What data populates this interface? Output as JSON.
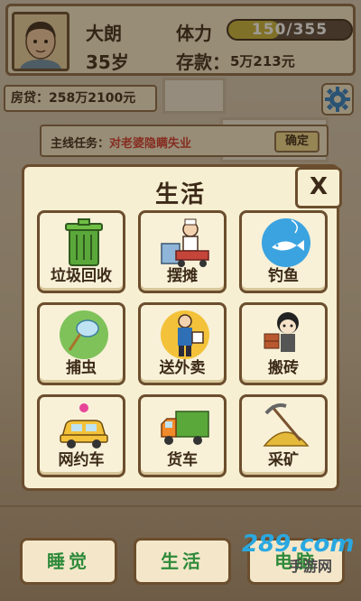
{
  "player": {
    "name": "大朗",
    "age": "35岁",
    "stamina_label": "体力",
    "stamina_text": "150/355",
    "stamina_fraction": 0.42,
    "savings_label": "存款：",
    "savings_value": "5万213元"
  },
  "mortgage": {
    "text": "房贷：258万2100元"
  },
  "quest": {
    "prefix": "主线任务：",
    "target": "对老婆隐瞒失业",
    "confirm_label": "确定"
  },
  "modal": {
    "title": "生活",
    "close_label": "X",
    "tiles": [
      {
        "label": "垃圾回收",
        "icon": "trash-can-icon"
      },
      {
        "label": "摆摊",
        "icon": "street-stall-icon"
      },
      {
        "label": "钓鱼",
        "icon": "fishing-icon"
      },
      {
        "label": "捕虫",
        "icon": "bug-net-icon"
      },
      {
        "label": "送外卖",
        "icon": "delivery-icon"
      },
      {
        "label": "搬砖",
        "icon": "brick-carrying-icon"
      },
      {
        "label": "网约车",
        "icon": "taxi-icon"
      },
      {
        "label": "货车",
        "icon": "truck-icon"
      },
      {
        "label": "采矿",
        "icon": "mining-icon"
      }
    ]
  },
  "nav": {
    "sleep_label": "睡觉",
    "life_label": "生活",
    "third_label": "电脑"
  },
  "watermark": {
    "num": "289.com",
    "text": "手游网"
  },
  "colors": {
    "panel_bg": "#f4e7c9",
    "border": "#6b4e2e",
    "quest_target": "#d23a2c",
    "nav_sleep": "#2e8a3a",
    "nav_life": "#2e8a3a"
  }
}
